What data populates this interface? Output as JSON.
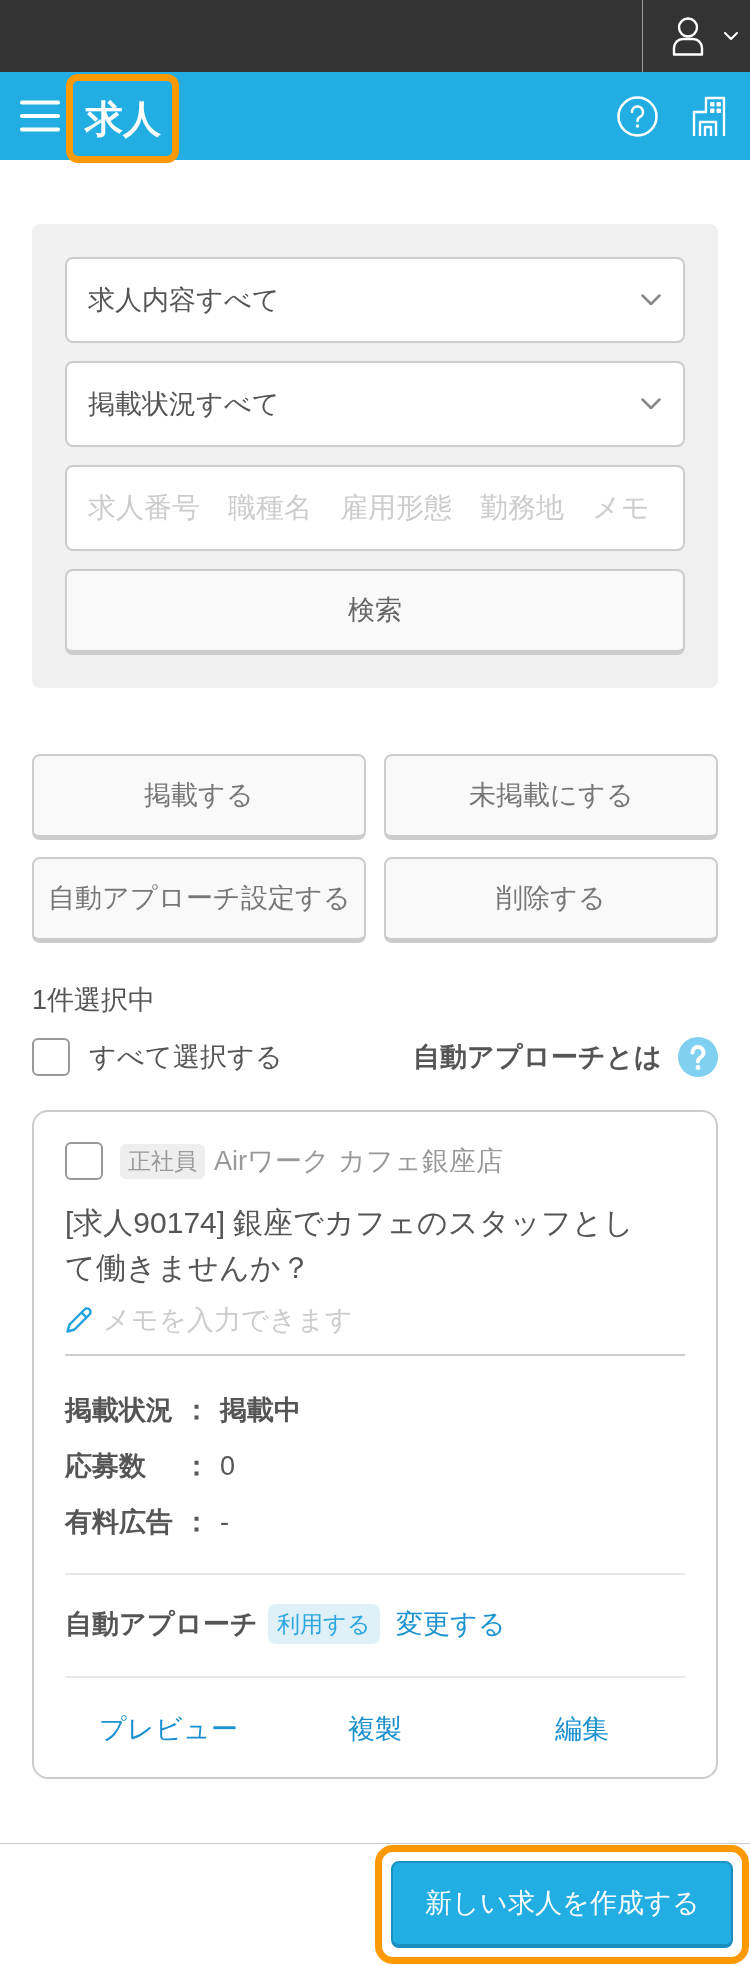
{
  "header": {
    "title": "求人",
    "highlighted": true
  },
  "filters": {
    "selects": [
      {
        "value": "求人内容すべて"
      },
      {
        "value": "掲載状況すべて"
      }
    ],
    "keyword": {
      "placeholder": "求人番号　職種名　雇用形態　勤務地　メモ"
    },
    "search_button": "検索"
  },
  "bulk_actions": [
    "掲載する",
    "未掲載にする",
    "自動アプローチ設定する",
    "削除する"
  ],
  "selection": {
    "count": "1件選択中",
    "select_all": {
      "label": "すべて選択する",
      "checked": false
    },
    "help_link": "自動アプローチとは"
  },
  "jobs": [
    {
      "checked": false,
      "employment_type": "正社員",
      "store": "Airワーク カフェ銀座店",
      "title": "[求人90174] 銀座でカフェのスタッフとして働きませんか？",
      "memo": {
        "placeholder": "メモを入力できます"
      },
      "details": [
        {
          "label": "掲載状況",
          "separator": "：",
          "value": "掲載中",
          "emphasized": true
        },
        {
          "label": "応募数",
          "separator": "：",
          "value": "0",
          "emphasized": false
        },
        {
          "label": "有料広告",
          "separator": "：",
          "value": "-",
          "emphasized": false
        }
      ],
      "auto_approach": {
        "label": "自動アプローチ",
        "status": "利用する",
        "change_link": "変更する"
      },
      "actions": [
        "プレビュー",
        "複製",
        "編集"
      ]
    }
  ],
  "footer": {
    "create_button": {
      "label": "新しい求人を作成する",
      "highlighted": true
    }
  }
}
